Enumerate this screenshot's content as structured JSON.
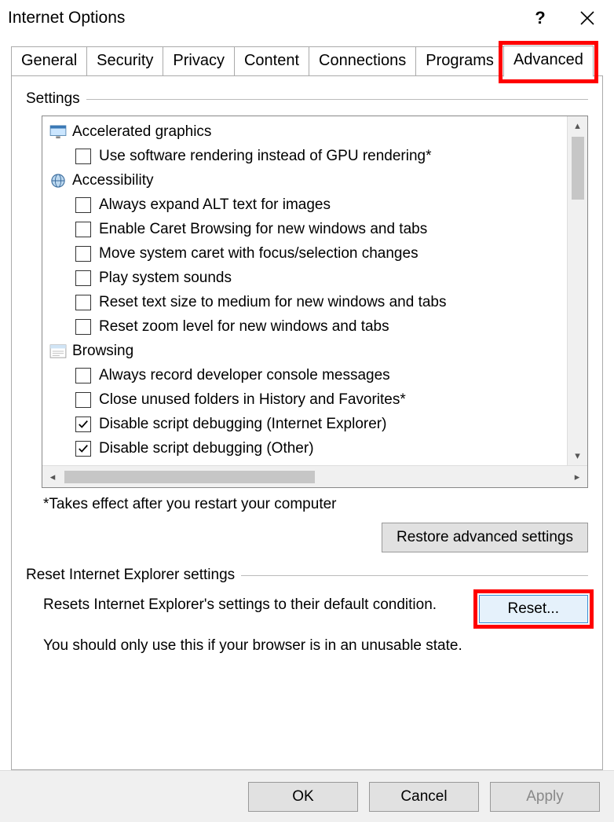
{
  "window": {
    "title": "Internet Options"
  },
  "tabs": {
    "items": [
      {
        "label": "General"
      },
      {
        "label": "Security"
      },
      {
        "label": "Privacy"
      },
      {
        "label": "Content"
      },
      {
        "label": "Connections"
      },
      {
        "label": "Programs"
      },
      {
        "label": "Advanced"
      }
    ],
    "active": "Advanced"
  },
  "settings_group": {
    "label": "Settings"
  },
  "tree": {
    "cats": {
      "accel": {
        "label": "Accelerated graphics"
      },
      "access": {
        "label": "Accessibility"
      },
      "browsing": {
        "label": "Browsing"
      }
    },
    "items": {
      "gpu": {
        "label": "Use software rendering instead of GPU rendering*",
        "checked": false
      },
      "alt": {
        "label": "Always expand ALT text for images",
        "checked": false
      },
      "caret": {
        "label": "Enable Caret Browsing for new windows and tabs",
        "checked": false
      },
      "move": {
        "label": "Move system caret with focus/selection changes",
        "checked": false
      },
      "sounds": {
        "label": "Play system sounds",
        "checked": false
      },
      "textsize": {
        "label": "Reset text size to medium for new windows and tabs",
        "checked": false
      },
      "zoom": {
        "label": "Reset zoom level for new windows and tabs",
        "checked": false
      },
      "devcon": {
        "label": "Always record developer console messages",
        "checked": false
      },
      "hist": {
        "label": "Close unused folders in History and Favorites*",
        "checked": false
      },
      "dbgie": {
        "label": "Disable script debugging (Internet Explorer)",
        "checked": true
      },
      "dbgo": {
        "label": "Disable script debugging (Other)",
        "checked": true
      }
    }
  },
  "footnote": "*Takes effect after you restart your computer",
  "restore_button": "Restore advanced settings",
  "reset_group": {
    "label": "Reset Internet Explorer settings"
  },
  "reset": {
    "desc": "Resets Internet Explorer's settings to their default condition.",
    "button": "Reset...",
    "warn": "You should only use this if your browser is in an unusable state."
  },
  "buttons": {
    "ok": "OK",
    "cancel": "Cancel",
    "apply": "Apply"
  }
}
